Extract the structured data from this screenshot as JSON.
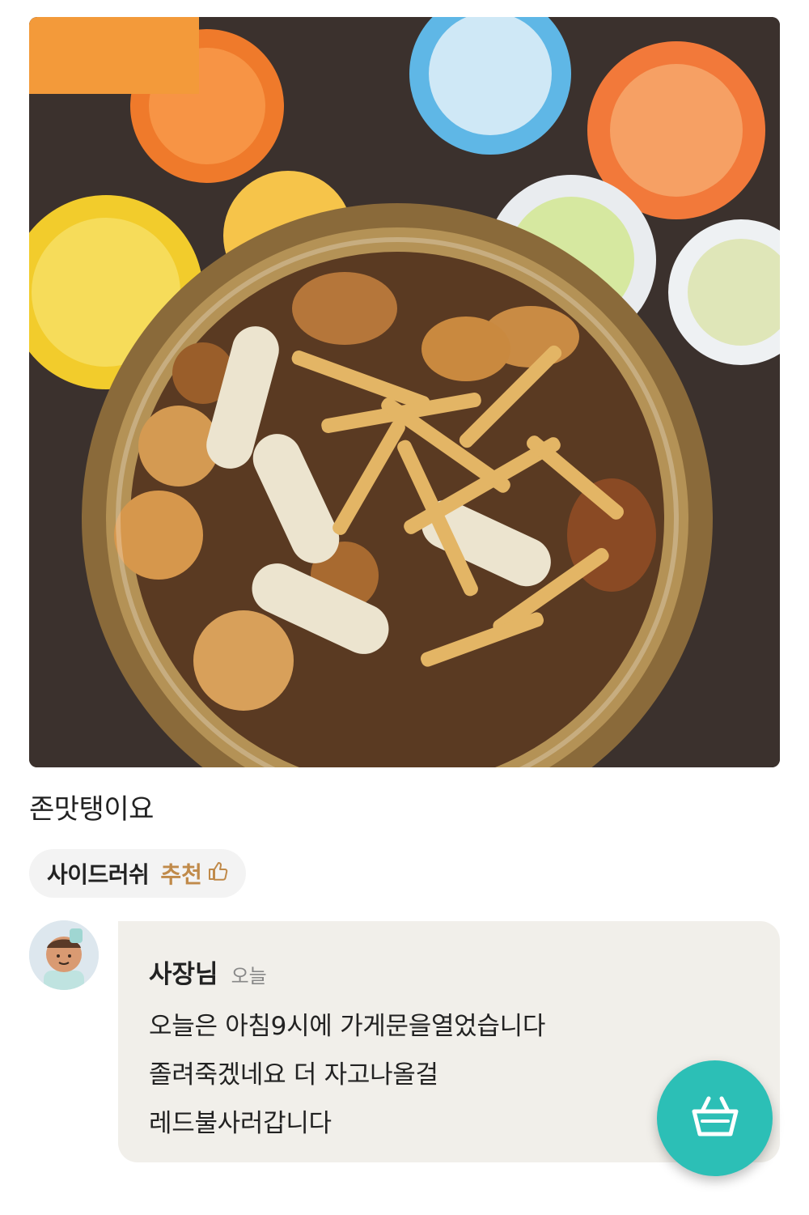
{
  "review": {
    "photo_icon": "food-photo-snack-bowl",
    "text": "존맛탱이요"
  },
  "menu_chip": {
    "menu_name": "사이드러쉬",
    "recommend_label": "추천",
    "recommend_icon": "thumbs-up-icon",
    "accent_color": "#c08a4a"
  },
  "owner_reply": {
    "name": "사장님",
    "time": "오늘",
    "lines": [
      "오늘은 아침9시에 가게문을열었습니다",
      "졸려죽겠네요 더 자고나올걸",
      "레드불사러갑니다"
    ]
  },
  "cart_button": {
    "icon": "basket-icon",
    "color": "#2cbfb6"
  }
}
